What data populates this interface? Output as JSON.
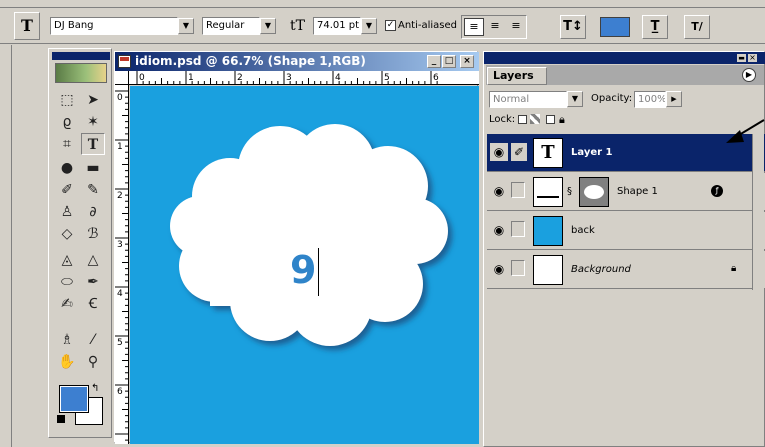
{
  "options_bar": {
    "tool_icon": "T",
    "font_family": "DJ Bang",
    "font_style": "Regular",
    "size_icon": "tT",
    "font_size": "74.01 pt",
    "antialias_label": "Anti-aliased",
    "color_swatch": "#3d7fd0"
  },
  "document": {
    "title": "idiom.psd @ 66.7% (Shape 1,RGB)",
    "ruler_h": [
      "0",
      "1",
      "2",
      "3",
      "4",
      "5",
      "6"
    ],
    "ruler_v": [
      "0",
      "1",
      "2",
      "3",
      "4",
      "5",
      "6"
    ],
    "canvas_color": "#1aa0df",
    "typed_text": "9"
  },
  "layers_palette": {
    "tab_label": "Layers",
    "blend_mode": "Normal",
    "opacity_label": "Opacity:",
    "opacity_value": "100%",
    "lock_label": "Lock:",
    "layers": [
      {
        "name": "Layer 1",
        "selected": true,
        "thumb": "T"
      },
      {
        "name": "Shape 1",
        "selected": false,
        "thumb": "shape"
      },
      {
        "name": "back",
        "selected": false,
        "thumb": "blue"
      },
      {
        "name": "Background",
        "selected": false,
        "thumb": "white"
      }
    ]
  }
}
